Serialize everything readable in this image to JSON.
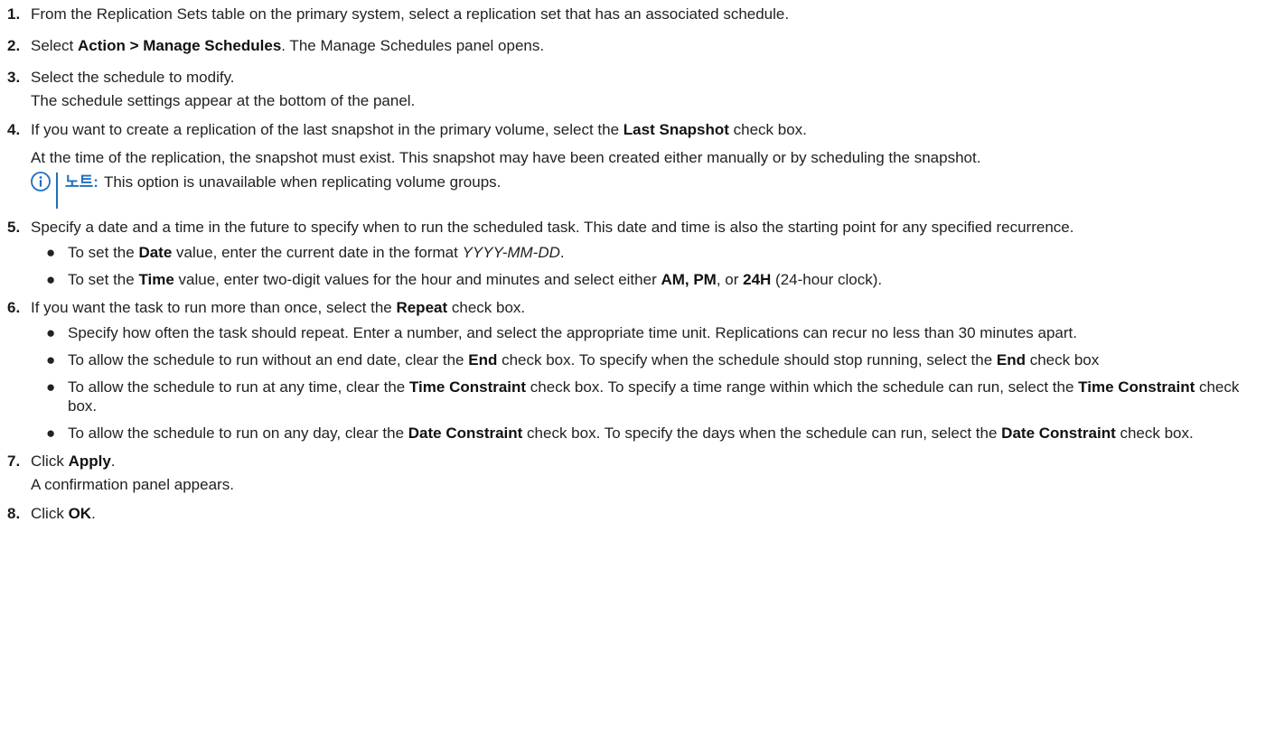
{
  "steps": [
    {
      "num": "1.",
      "text": "From the Replication Sets table on the primary system, select a replication set that has an associated schedule."
    },
    {
      "num": "2.",
      "pre": "Select ",
      "bold": "Action > Manage Schedules",
      "post": ". The Manage Schedules panel opens."
    },
    {
      "num": "3.",
      "line1": "Select the schedule to modify.",
      "line2": "The schedule settings appear at the bottom of the panel."
    },
    {
      "num": "4.",
      "pre": "If you want to create a replication of the last snapshot in the primary volume, select the ",
      "bold": "Last Snapshot",
      "post": " check box.",
      "para": "At the time of the replication, the snapshot must exist. This snapshot may have been created either manually or by scheduling the snapshot.",
      "note_label": "노트:",
      "note_text": "This option is unavailable when replicating volume groups."
    },
    {
      "num": "5.",
      "text": "Specify a date and a time in the future to specify when to run the scheduled task. This date and time is also the starting point for any specified recurrence.",
      "b1_pre": "To set the ",
      "b1_bold": "Date",
      "b1_mid": " value, enter the current date in the format ",
      "b1_italic": "YYYY-MM-DD",
      "b1_post": ".",
      "b2_pre": "To set the ",
      "b2_bold": "Time",
      "b2_mid": " value, enter two-digit values for the hour and minutes and select either ",
      "b2_bold2": "AM, PM",
      "b2_mid2": ", or ",
      "b2_bold3": "24H",
      "b2_post": " (24-hour clock)."
    },
    {
      "num": "6.",
      "pre": "If you want the task to run more than once, select the ",
      "bold": "Repeat",
      "post": " check box.",
      "b1": "Specify how often the task should repeat. Enter a number, and select the appropriate time unit. Replications can recur no less than 30 minutes apart.",
      "b2_pre": "To allow the schedule to run without an end date, clear the ",
      "b2_bold": "End",
      "b2_mid": " check box. To specify when the schedule should stop running, select the ",
      "b2_bold2": "End",
      "b2_post": " check box",
      "b3_pre": "To allow the schedule to run at any time, clear the ",
      "b3_bold": "Time Constraint",
      "b3_mid": " check box. To specify a time range within which the schedule can run, select the ",
      "b3_bold2": "Time Constraint",
      "b3_post": " check box.",
      "b4_pre": "To allow the schedule to run on any day, clear the ",
      "b4_bold": "Date Constraint",
      "b4_mid": " check box. To specify the days when the schedule can run, select the ",
      "b4_bold2": "Date Constraint",
      "b4_post": " check box."
    },
    {
      "num": "7.",
      "pre": "Click ",
      "bold": "Apply",
      "post": ".",
      "line2": "A confirmation panel appears."
    },
    {
      "num": "8.",
      "pre": "Click ",
      "bold": "OK",
      "post": "."
    }
  ],
  "bullet_char": "●",
  "icons": {
    "note": "info-circle-icon"
  },
  "colors": {
    "accent": "#1f70c1"
  }
}
